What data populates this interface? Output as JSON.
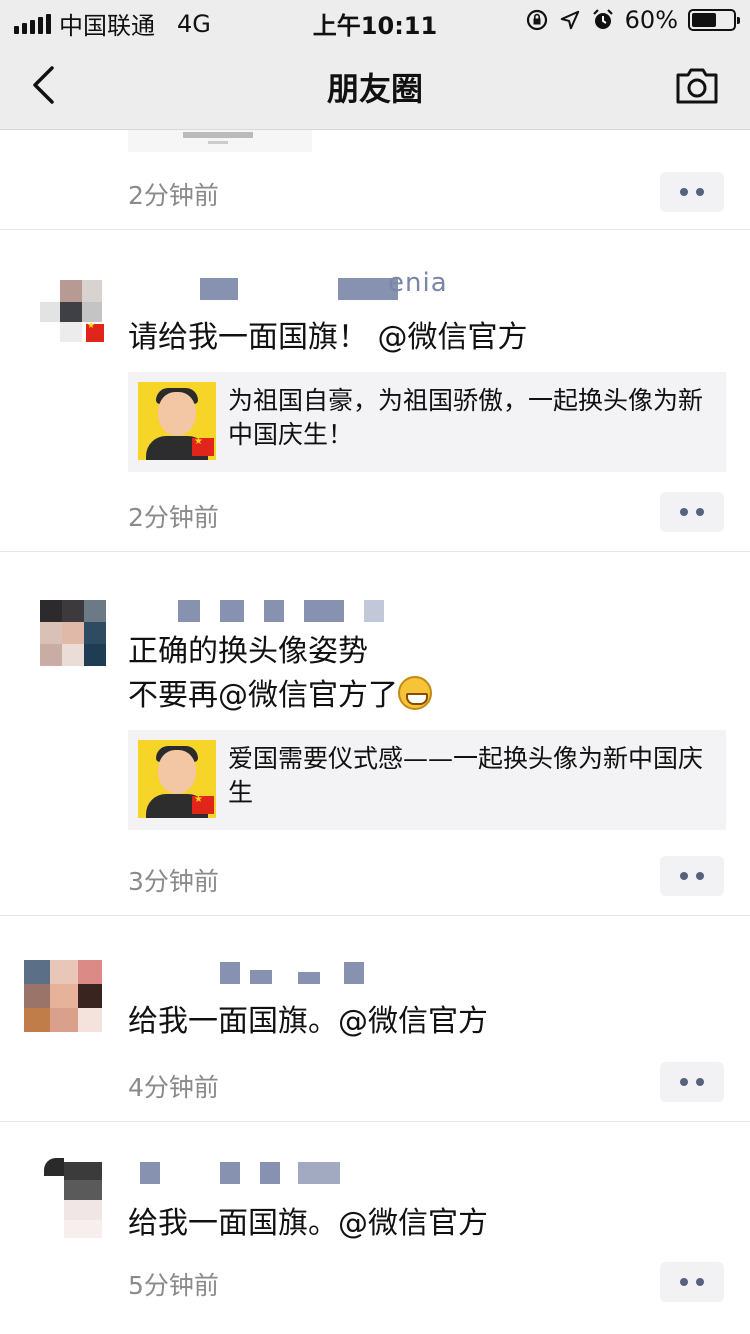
{
  "status_bar": {
    "carrier": "中国联通",
    "network": "4G",
    "time": "上午10:11",
    "battery": "60%"
  },
  "nav": {
    "title": "朋友圈"
  },
  "feed": {
    "partial_time": "2分钟前",
    "posts": [
      {
        "name_visible": "enia",
        "text": "请给我一面国旗！ @微信官方",
        "link_title": "为祖国自豪，为祖国骄傲，一起换头像为新中国庆生！",
        "time": "2分钟前"
      },
      {
        "text": "正确的换头像姿势\n不要再@微信官方了",
        "link_title": "爱国需要仪式感——一起换头像为新中国庆生",
        "time": "3分钟前"
      },
      {
        "text": "给我一面国旗。@微信官方",
        "time": "4分钟前"
      },
      {
        "text": "给我一面国旗。@微信官方",
        "time": "5分钟前"
      }
    ]
  },
  "colors": {
    "nav_bg": "#ededed",
    "time_gray": "#8a8a8a",
    "more_dots": "#56617f",
    "link_card_bg": "#f3f3f5"
  },
  "icons": [
    "back-chevron-icon",
    "camera-icon",
    "lock-rotation-icon",
    "location-arrow-icon",
    "alarm-icon",
    "grin-emoji-icon"
  ]
}
